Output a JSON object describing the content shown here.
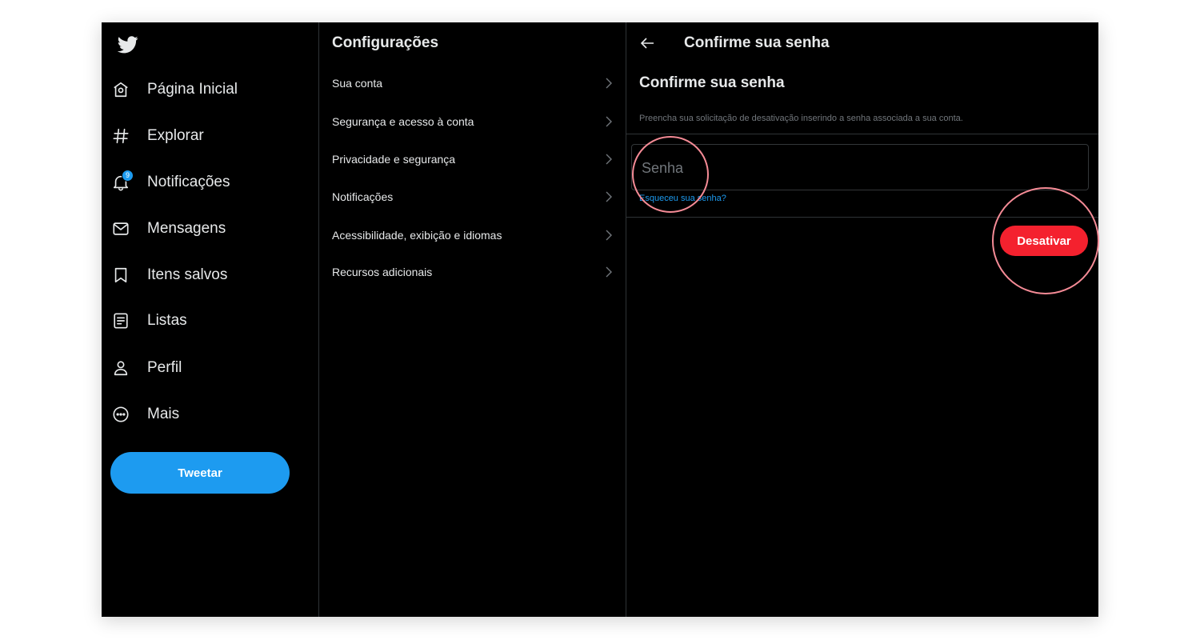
{
  "nav": {
    "logo_icon": "twitter-bird-icon",
    "items": [
      {
        "label": "Página Inicial",
        "icon": "home-icon"
      },
      {
        "label": "Explorar",
        "icon": "hashtag-icon"
      },
      {
        "label": "Notificações",
        "icon": "bell-icon",
        "badge": "9"
      },
      {
        "label": "Mensagens",
        "icon": "envelope-icon"
      },
      {
        "label": "Itens salvos",
        "icon": "bookmark-icon"
      },
      {
        "label": "Listas",
        "icon": "list-icon"
      },
      {
        "label": "Perfil",
        "icon": "user-icon"
      },
      {
        "label": "Mais",
        "icon": "more-circle-icon"
      }
    ],
    "tweet_button": "Tweetar"
  },
  "settings": {
    "title": "Configurações",
    "items": [
      {
        "label": "Sua conta"
      },
      {
        "label": "Segurança e acesso à conta"
      },
      {
        "label": "Privacidade e segurança"
      },
      {
        "label": "Notificações"
      },
      {
        "label": "Acessibilidade, exibição e idiomas"
      },
      {
        "label": "Recursos adicionais"
      }
    ]
  },
  "detail": {
    "header_title": "Confirme sua senha",
    "title": "Confirme sua senha",
    "description": "Preencha sua solicitação de desativação inserindo a senha associada a sua conta.",
    "password_placeholder": "Senha",
    "password_value": "",
    "forgot_link": "Esqueceu sua senha?",
    "deactivate_button": "Desativar"
  },
  "colors": {
    "background": "#000000",
    "text": "#e7e9ea",
    "muted": "#71767b",
    "accent": "#1d9bf0",
    "danger": "#f4212e",
    "highlight": "#f58b96"
  }
}
